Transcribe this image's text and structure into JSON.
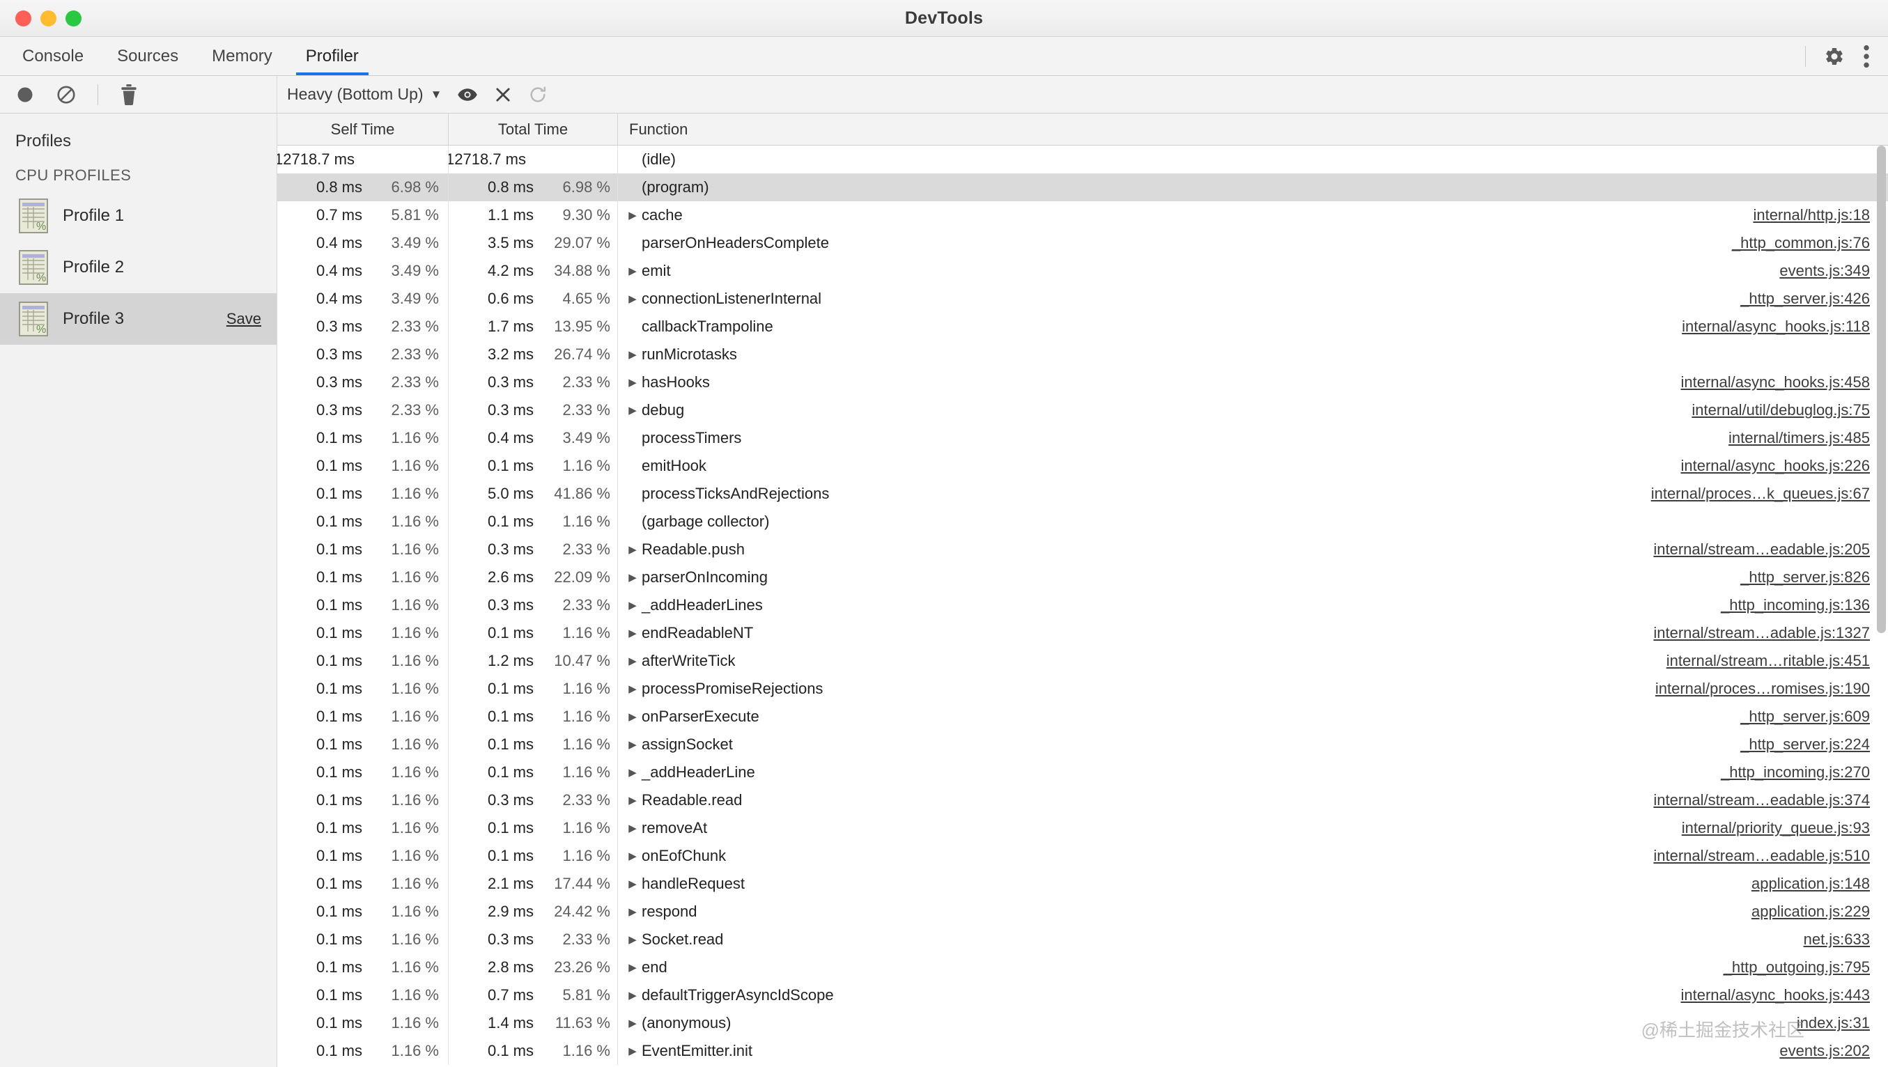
{
  "window": {
    "title": "DevTools",
    "traffic_lights": [
      "close-red",
      "minimize-yellow",
      "zoom-green"
    ]
  },
  "tabs": [
    {
      "label": "Console",
      "active": false
    },
    {
      "label": "Sources",
      "active": false
    },
    {
      "label": "Memory",
      "active": false
    },
    {
      "label": "Profiler",
      "active": true
    }
  ],
  "tabstrip_right": {
    "settings_icon": "gear-icon",
    "more_icon": "kebab-menu-icon"
  },
  "toolbar": {
    "record_icon": "record-circle-icon",
    "clear_icon": "no-entry-icon",
    "delete_icon": "trash-icon",
    "view_mode": "Heavy (Bottom Up)",
    "caret": "▼",
    "focus_icon": "eye-icon",
    "exclude_icon": "close-x-icon",
    "restore_icon": "refresh-icon"
  },
  "sidebar": {
    "title": "Profiles",
    "section": "CPU PROFILES",
    "items": [
      {
        "label": "Profile 1",
        "selected": false,
        "save_label": ""
      },
      {
        "label": "Profile 2",
        "selected": false,
        "save_label": ""
      },
      {
        "label": "Profile 3",
        "selected": true,
        "save_label": "Save"
      }
    ]
  },
  "table": {
    "columns": [
      "Self Time",
      "Total Time",
      "Function"
    ],
    "rows": [
      {
        "self_ms": "12718.7 ms",
        "self_pct": "",
        "total_ms": "12718.7 ms",
        "total_pct": "",
        "expandable": false,
        "func": "(idle)",
        "url": "",
        "selected": false,
        "overflow": true
      },
      {
        "self_ms": "0.8 ms",
        "self_pct": "6.98 %",
        "total_ms": "0.8 ms",
        "total_pct": "6.98 %",
        "expandable": false,
        "func": "(program)",
        "url": "",
        "selected": true
      },
      {
        "self_ms": "0.7 ms",
        "self_pct": "5.81 %",
        "total_ms": "1.1 ms",
        "total_pct": "9.30 %",
        "expandable": true,
        "func": "cache",
        "url": "internal/http.js:18",
        "selected": false
      },
      {
        "self_ms": "0.4 ms",
        "self_pct": "3.49 %",
        "total_ms": "3.5 ms",
        "total_pct": "29.07 %",
        "expandable": false,
        "func": "parserOnHeadersComplete",
        "url": "_http_common.js:76",
        "selected": false
      },
      {
        "self_ms": "0.4 ms",
        "self_pct": "3.49 %",
        "total_ms": "4.2 ms",
        "total_pct": "34.88 %",
        "expandable": true,
        "func": "emit",
        "url": "events.js:349",
        "selected": false
      },
      {
        "self_ms": "0.4 ms",
        "self_pct": "3.49 %",
        "total_ms": "0.6 ms",
        "total_pct": "4.65 %",
        "expandable": true,
        "func": "connectionListenerInternal",
        "url": "_http_server.js:426",
        "selected": false
      },
      {
        "self_ms": "0.3 ms",
        "self_pct": "2.33 %",
        "total_ms": "1.7 ms",
        "total_pct": "13.95 %",
        "expandable": false,
        "func": "callbackTrampoline",
        "url": "internal/async_hooks.js:118",
        "selected": false
      },
      {
        "self_ms": "0.3 ms",
        "self_pct": "2.33 %",
        "total_ms": "3.2 ms",
        "total_pct": "26.74 %",
        "expandable": true,
        "func": "runMicrotasks",
        "url": "",
        "selected": false
      },
      {
        "self_ms": "0.3 ms",
        "self_pct": "2.33 %",
        "total_ms": "0.3 ms",
        "total_pct": "2.33 %",
        "expandable": true,
        "func": "hasHooks",
        "url": "internal/async_hooks.js:458",
        "selected": false
      },
      {
        "self_ms": "0.3 ms",
        "self_pct": "2.33 %",
        "total_ms": "0.3 ms",
        "total_pct": "2.33 %",
        "expandable": true,
        "func": "debug",
        "url": "internal/util/debuglog.js:75",
        "selected": false
      },
      {
        "self_ms": "0.1 ms",
        "self_pct": "1.16 %",
        "total_ms": "0.4 ms",
        "total_pct": "3.49 %",
        "expandable": false,
        "func": "processTimers",
        "url": "internal/timers.js:485",
        "selected": false
      },
      {
        "self_ms": "0.1 ms",
        "self_pct": "1.16 %",
        "total_ms": "0.1 ms",
        "total_pct": "1.16 %",
        "expandable": false,
        "func": "emitHook",
        "url": "internal/async_hooks.js:226",
        "selected": false
      },
      {
        "self_ms": "0.1 ms",
        "self_pct": "1.16 %",
        "total_ms": "5.0 ms",
        "total_pct": "41.86 %",
        "expandable": false,
        "func": "processTicksAndRejections",
        "url": "internal/proces…k_queues.js:67",
        "selected": false
      },
      {
        "self_ms": "0.1 ms",
        "self_pct": "1.16 %",
        "total_ms": "0.1 ms",
        "total_pct": "1.16 %",
        "expandable": false,
        "func": "(garbage collector)",
        "url": "",
        "selected": false
      },
      {
        "self_ms": "0.1 ms",
        "self_pct": "1.16 %",
        "total_ms": "0.3 ms",
        "total_pct": "2.33 %",
        "expandable": true,
        "func": "Readable.push",
        "url": "internal/stream…eadable.js:205",
        "selected": false
      },
      {
        "self_ms": "0.1 ms",
        "self_pct": "1.16 %",
        "total_ms": "2.6 ms",
        "total_pct": "22.09 %",
        "expandable": true,
        "func": "parserOnIncoming",
        "url": "_http_server.js:826",
        "selected": false
      },
      {
        "self_ms": "0.1 ms",
        "self_pct": "1.16 %",
        "total_ms": "0.3 ms",
        "total_pct": "2.33 %",
        "expandable": true,
        "func": "_addHeaderLines",
        "url": "_http_incoming.js:136",
        "selected": false
      },
      {
        "self_ms": "0.1 ms",
        "self_pct": "1.16 %",
        "total_ms": "0.1 ms",
        "total_pct": "1.16 %",
        "expandable": true,
        "func": "endReadableNT",
        "url": "internal/stream…adable.js:1327",
        "selected": false
      },
      {
        "self_ms": "0.1 ms",
        "self_pct": "1.16 %",
        "total_ms": "1.2 ms",
        "total_pct": "10.47 %",
        "expandable": true,
        "func": "afterWriteTick",
        "url": "internal/stream…ritable.js:451",
        "selected": false
      },
      {
        "self_ms": "0.1 ms",
        "self_pct": "1.16 %",
        "total_ms": "0.1 ms",
        "total_pct": "1.16 %",
        "expandable": true,
        "func": "processPromiseRejections",
        "url": "internal/proces…romises.js:190",
        "selected": false
      },
      {
        "self_ms": "0.1 ms",
        "self_pct": "1.16 %",
        "total_ms": "0.1 ms",
        "total_pct": "1.16 %",
        "expandable": true,
        "func": "onParserExecute",
        "url": "_http_server.js:609",
        "selected": false
      },
      {
        "self_ms": "0.1 ms",
        "self_pct": "1.16 %",
        "total_ms": "0.1 ms",
        "total_pct": "1.16 %",
        "expandable": true,
        "func": "assignSocket",
        "url": "_http_server.js:224",
        "selected": false
      },
      {
        "self_ms": "0.1 ms",
        "self_pct": "1.16 %",
        "total_ms": "0.1 ms",
        "total_pct": "1.16 %",
        "expandable": true,
        "func": "_addHeaderLine",
        "url": "_http_incoming.js:270",
        "selected": false
      },
      {
        "self_ms": "0.1 ms",
        "self_pct": "1.16 %",
        "total_ms": "0.3 ms",
        "total_pct": "2.33 %",
        "expandable": true,
        "func": "Readable.read",
        "url": "internal/stream…eadable.js:374",
        "selected": false
      },
      {
        "self_ms": "0.1 ms",
        "self_pct": "1.16 %",
        "total_ms": "0.1 ms",
        "total_pct": "1.16 %",
        "expandable": true,
        "func": "removeAt",
        "url": "internal/priority_queue.js:93",
        "selected": false
      },
      {
        "self_ms": "0.1 ms",
        "self_pct": "1.16 %",
        "total_ms": "0.1 ms",
        "total_pct": "1.16 %",
        "expandable": true,
        "func": "onEofChunk",
        "url": "internal/stream…eadable.js:510",
        "selected": false
      },
      {
        "self_ms": "0.1 ms",
        "self_pct": "1.16 %",
        "total_ms": "2.1 ms",
        "total_pct": "17.44 %",
        "expandable": true,
        "func": "handleRequest",
        "url": "application.js:148",
        "selected": false
      },
      {
        "self_ms": "0.1 ms",
        "self_pct": "1.16 %",
        "total_ms": "2.9 ms",
        "total_pct": "24.42 %",
        "expandable": true,
        "func": "respond",
        "url": "application.js:229",
        "selected": false
      },
      {
        "self_ms": "0.1 ms",
        "self_pct": "1.16 %",
        "total_ms": "0.3 ms",
        "total_pct": "2.33 %",
        "expandable": true,
        "func": "Socket.read",
        "url": "net.js:633",
        "selected": false
      },
      {
        "self_ms": "0.1 ms",
        "self_pct": "1.16 %",
        "total_ms": "2.8 ms",
        "total_pct": "23.26 %",
        "expandable": true,
        "func": "end",
        "url": "_http_outgoing.js:795",
        "selected": false
      },
      {
        "self_ms": "0.1 ms",
        "self_pct": "1.16 %",
        "total_ms": "0.7 ms",
        "total_pct": "5.81 %",
        "expandable": true,
        "func": "defaultTriggerAsyncIdScope",
        "url": "internal/async_hooks.js:443",
        "selected": false
      },
      {
        "self_ms": "0.1 ms",
        "self_pct": "1.16 %",
        "total_ms": "1.4 ms",
        "total_pct": "11.63 %",
        "expandable": true,
        "func": "(anonymous)",
        "url": "index.js:31",
        "selected": false
      },
      {
        "self_ms": "0.1 ms",
        "self_pct": "1.16 %",
        "total_ms": "0.1 ms",
        "total_pct": "1.16 %",
        "expandable": true,
        "func": "EventEmitter.init",
        "url": "events.js:202",
        "selected": false
      }
    ]
  },
  "watermark": "@稀土掘金技术社区",
  "colors": {
    "accent": "#1a73e8",
    "selected_row": "#dadada",
    "sidebar_bg": "#f2f2f2",
    "toolbar_bg": "#f3f3f3"
  }
}
